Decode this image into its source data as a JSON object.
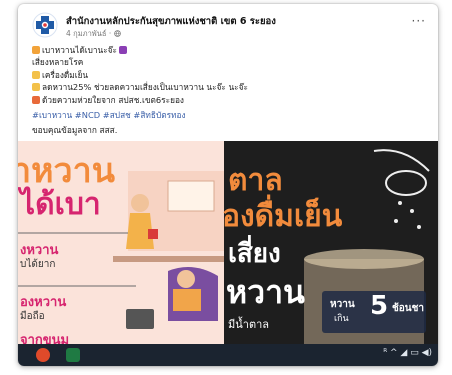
{
  "post": {
    "page_name": "สำนักงานหลักประกันสุขภาพแห่งชาติ เขต 6 ระยอง",
    "meta": "4 กุมภาพันธ์ · ",
    "more_label": "···",
    "lines": [
      "เบาหวานได้เบานะจ๊ะ",
      "เสี่ยงหลายโรค",
      "เครื่องดื่มเย็น",
      "ลดหวาน25% ช่วยลดความเสี่ยงเป็นเบาหวาน นะจ๊ะ นะจ๊ะ",
      "ด้วยความห่วยใยจาก สปสช.เขต6ระยอง"
    ],
    "hashtags": "#เบาหวาน #NCD #สปสช #สิทธิบัตรทอง",
    "thanks": "ขอบคุณข้อมูลจาก สสส."
  },
  "image_left": {
    "title1": "าหวาน",
    "title2": "ได้เบา",
    "label1": "งหวาน",
    "sub1": "บได้ยาก",
    "label2": "องหวาน",
    "sub2": "มือถือ",
    "label3": "จากขนม"
  },
  "image_right": {
    "line1": "ตาล",
    "line2": "องดื่มเย็น",
    "line3": "เสี่ยง",
    "line4": "หวาน",
    "line5": "มีน้ำตาล",
    "badge_label1": "หวาน",
    "badge_label2": "เกิน",
    "badge_number": "5",
    "badge_unit": "ช้อนชา"
  },
  "taskbar": {
    "tray_text": "ᴿ  ^  ◢  ▭  ◀)"
  },
  "colors": {
    "accent": "#1877f2",
    "left_bg": "#fbe3da",
    "right_bg": "#1e1e1e",
    "pink_title": "#d6256f",
    "orange_title": "#f28b3c"
  }
}
